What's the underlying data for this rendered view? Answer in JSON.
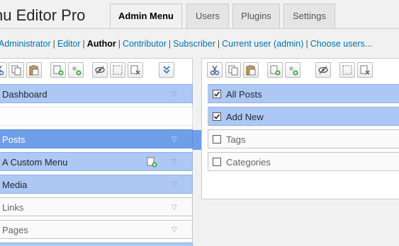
{
  "app": {
    "title": "nu Editor Pro"
  },
  "tabs": [
    {
      "label": "Admin Menu",
      "active": true
    },
    {
      "label": "Users",
      "active": false
    },
    {
      "label": "Plugins",
      "active": false
    },
    {
      "label": "Settings",
      "active": false
    }
  ],
  "roles": {
    "administrator": "Administrator",
    "editor": "Editor",
    "author": "Author",
    "contributor": "Contributor",
    "subscriber": "Subscriber",
    "current_user": "Current user (admin)",
    "choose_users": "Choose users...",
    "active": "Author"
  },
  "left_menu": {
    "items": [
      {
        "label": "Dashboard"
      },
      {
        "label": ""
      },
      {
        "label": "Posts"
      },
      {
        "label": "A Custom Menu"
      },
      {
        "label": "Media"
      },
      {
        "label": "Links"
      },
      {
        "label": "Pages"
      }
    ],
    "arrow": "▽"
  },
  "right_menu": {
    "items": [
      {
        "label": "All Posts",
        "checked": true
      },
      {
        "label": "Add New",
        "checked": true
      },
      {
        "label": "Tags",
        "checked": false
      },
      {
        "label": "Categories",
        "checked": false
      }
    ],
    "arrow": "▽"
  },
  "colors": {
    "highlight": "#aec8f5",
    "selected": "#6e9fe8",
    "link": "#0073aa"
  },
  "icons": {
    "toolbar_left": [
      "cut-icon",
      "copy-icon",
      "paste-icon",
      "new-menu-icon",
      "new-separator-icon",
      "hide-icon",
      "select-all-icon",
      "delete-icon",
      "expand-icon"
    ],
    "toolbar_right": [
      "cut-icon",
      "copy-icon",
      "paste-icon",
      "new-menu-icon",
      "new-separator-icon",
      "hide-icon",
      "select-all-icon",
      "delete-icon"
    ]
  }
}
